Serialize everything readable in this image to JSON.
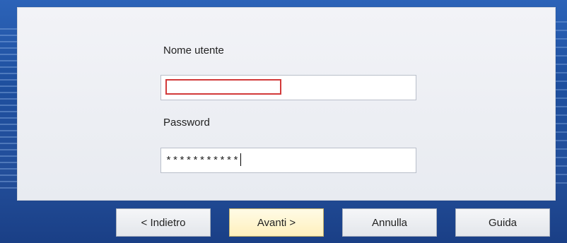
{
  "form": {
    "username_label": "Nome utente",
    "username_value": "",
    "password_label": "Password",
    "password_value": "***********"
  },
  "buttons": {
    "back": "< Indietro",
    "next": "Avanti >",
    "cancel": "Annulla",
    "help": "Guida"
  },
  "colors": {
    "background": "#1f4d9a",
    "focus_border": "#d23a3a",
    "primary_button": "#fff0bd"
  }
}
